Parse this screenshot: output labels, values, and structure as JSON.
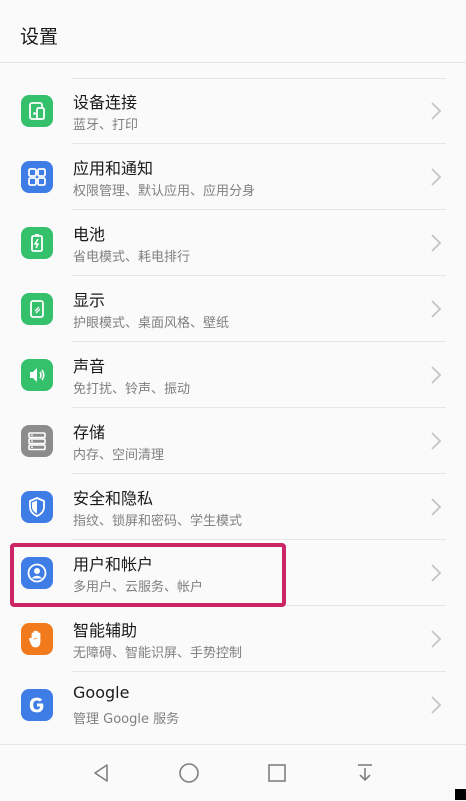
{
  "header": {
    "title": "设置"
  },
  "items": [
    {
      "label": "设备连接",
      "sub": "蓝牙、打印",
      "icon": "device-connect-icon",
      "color": "#35c06c"
    },
    {
      "label": "应用和通知",
      "sub": "权限管理、默认应用、应用分身",
      "icon": "apps-grid-icon",
      "color": "#3e7de6"
    },
    {
      "label": "电池",
      "sub": "省电模式、耗电排行",
      "icon": "battery-icon",
      "color": "#35c06c"
    },
    {
      "label": "显示",
      "sub": "护眼模式、桌面风格、壁纸",
      "icon": "display-icon",
      "color": "#35c06c"
    },
    {
      "label": "声音",
      "sub": "免打扰、铃声、振动",
      "icon": "speaker-icon",
      "color": "#35c06c"
    },
    {
      "label": "存储",
      "sub": "内存、空间清理",
      "icon": "storage-icon",
      "color": "#8c8c8c"
    },
    {
      "label": "安全和隐私",
      "sub": "指纹、锁屏和密码、学生模式",
      "icon": "shield-icon",
      "color": "#3e7de6"
    },
    {
      "label": "用户和帐户",
      "sub": "多用户、云服务、帐户",
      "icon": "user-icon",
      "color": "#3e7de6"
    },
    {
      "label": "智能辅助",
      "sub": "无障碍、智能识屏、手势控制",
      "icon": "hand-icon",
      "color": "#f07a1c"
    },
    {
      "label": "Google",
      "sub": "管理 Google 服务",
      "icon": "google-icon",
      "color": "#3e7de6"
    }
  ],
  "colors": {
    "highlight": "#cc2566"
  },
  "navbar": {
    "icons": [
      "back-icon",
      "home-icon",
      "recents-icon",
      "notification-pull-icon"
    ]
  }
}
